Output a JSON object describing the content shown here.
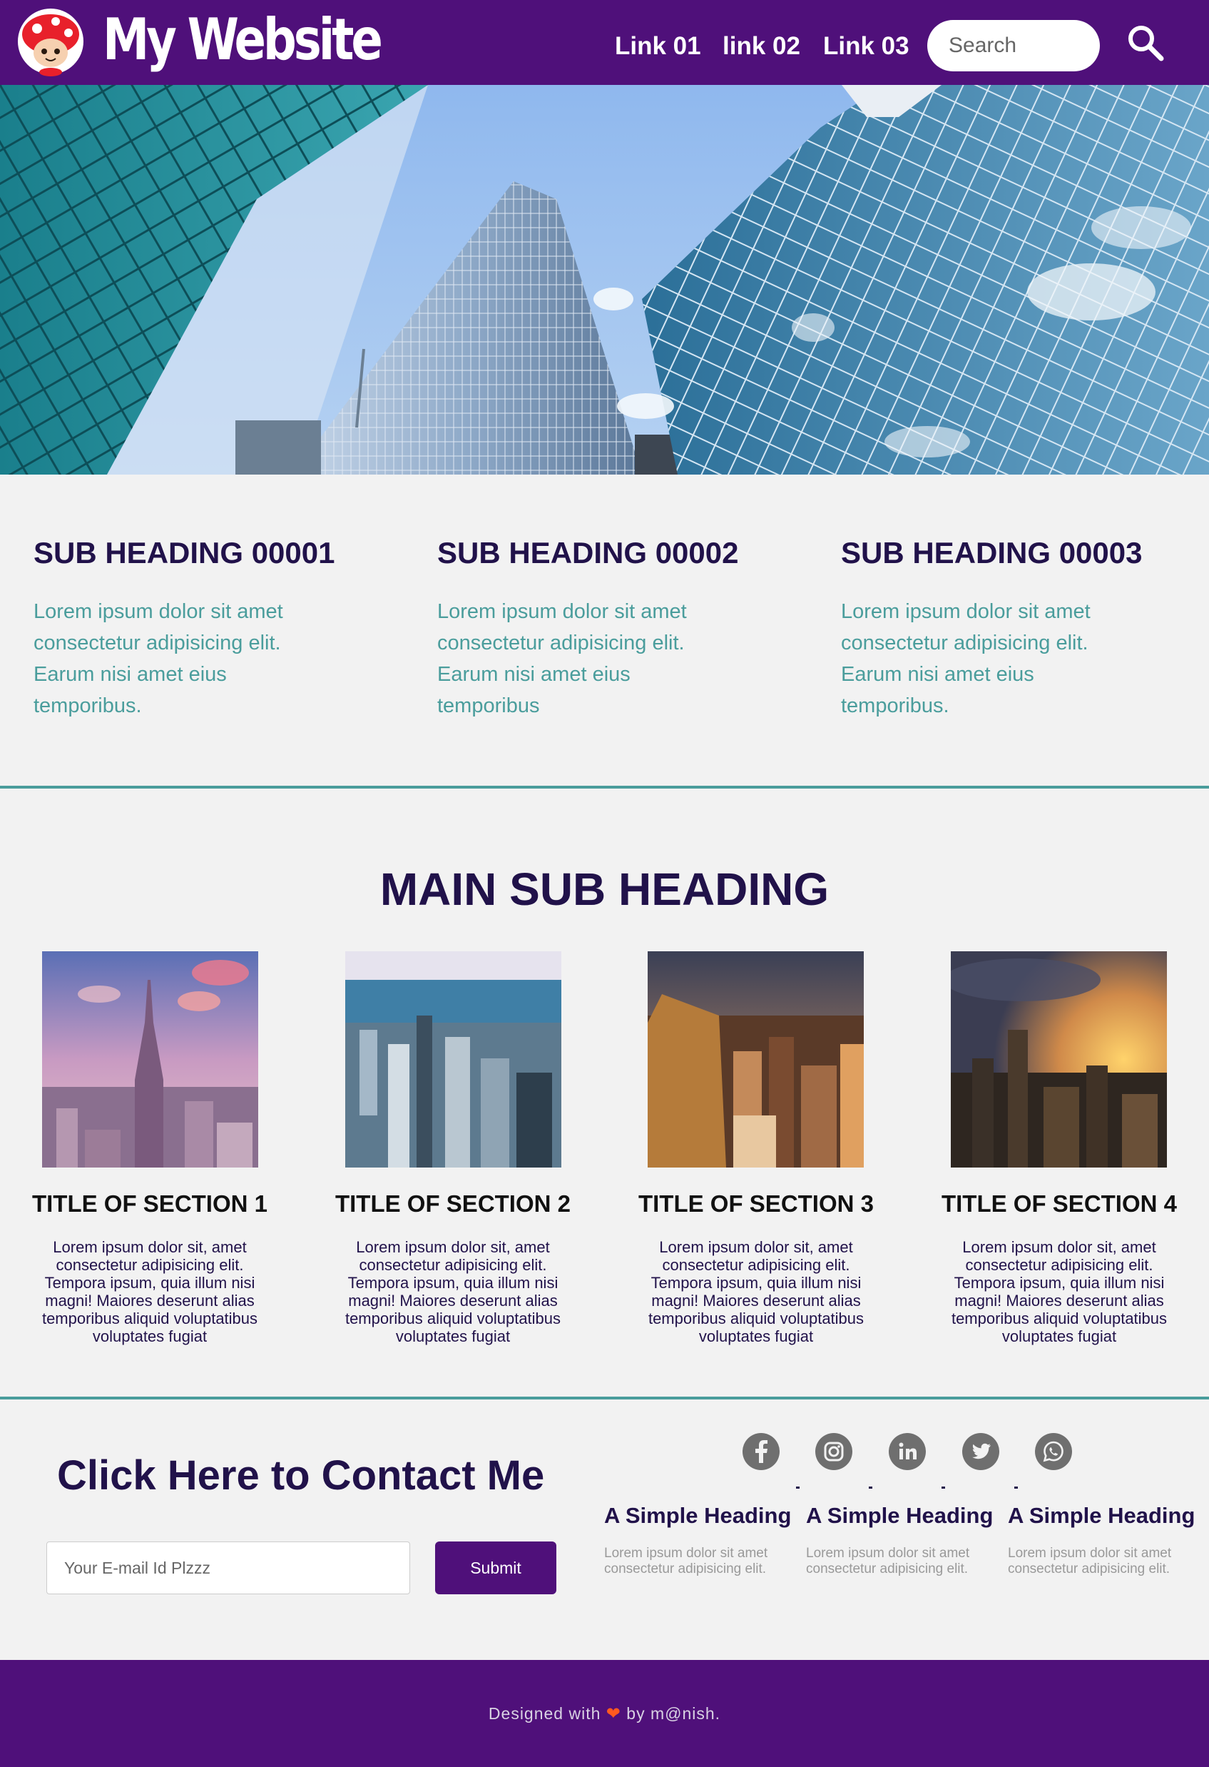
{
  "header": {
    "logo_text": "My Website",
    "nav_links": [
      "Link 01",
      "link 02",
      "Link 03"
    ],
    "search_placeholder": "Search"
  },
  "features": [
    {
      "heading": "SUB HEADING 00001",
      "text": "Lorem ipsum dolor sit amet consectetur adipisicing elit. Earum nisi amet eius temporibus."
    },
    {
      "heading": "SUB HEADING 00002",
      "text": "Lorem ipsum dolor sit amet consectetur adipisicing elit. Earum nisi amet eius temporibus"
    },
    {
      "heading": "SUB HEADING 00003",
      "text": "Lorem ipsum dolor sit amet consectetur adipisicing elit. Earum nisi amet eius temporibus."
    }
  ],
  "main_heading": "MAIN SUB HEADING",
  "sections": [
    {
      "title": "TITLE OF SECTION 1",
      "text": "Lorem ipsum dolor sit, amet consectetur adipisicing elit. Tempora ipsum, quia illum nisi magni! Maiores deserunt alias temporibus aliquid voluptatibus voluptates fugiat"
    },
    {
      "title": "TITLE OF SECTION 2",
      "text": "Lorem ipsum dolor sit, amet consectetur adipisicing elit. Tempora ipsum, quia illum nisi magni! Maiores deserunt alias temporibus aliquid voluptatibus voluptates fugiat"
    },
    {
      "title": "TITLE OF SECTION 3",
      "text": "Lorem ipsum dolor sit, amet consectetur adipisicing elit. Tempora ipsum, quia illum nisi magni! Maiores deserunt alias temporibus aliquid voluptatibus voluptates fugiat"
    },
    {
      "title": "TITLE OF SECTION 4",
      "text": "Lorem ipsum dolor sit, amet consectetur adipisicing elit. Tempora ipsum, quia illum nisi magni! Maiores deserunt alias temporibus aliquid voluptatibus voluptates fugiat"
    }
  ],
  "contact": {
    "heading": "Click Here to Contact Me",
    "email_placeholder": "Your E-mail Id Plzzz",
    "submit_label": "Submit"
  },
  "social_icons": [
    "facebook-icon",
    "instagram-icon",
    "linkedin-icon",
    "twitter-icon",
    "whatsapp-icon"
  ],
  "mini_columns": [
    {
      "heading": "A Simple Heading",
      "text": "Lorem ipsum dolor sit amet consectetur adipisicing elit."
    },
    {
      "heading": "A Simple Heading",
      "text": "Lorem ipsum dolor sit amet consectetur adipisicing elit."
    },
    {
      "heading": "A Simple Heading",
      "text": "Lorem ipsum dolor sit amet consectetur adipisicing elit."
    }
  ],
  "footer": {
    "prefix": "Designed with",
    "suffix": "by m@nish."
  },
  "colors": {
    "brand_purple": "#4f107a",
    "dark_navy": "#21124a",
    "teal": "#4a9d9c",
    "footer_heart": "#ff5a1f"
  }
}
